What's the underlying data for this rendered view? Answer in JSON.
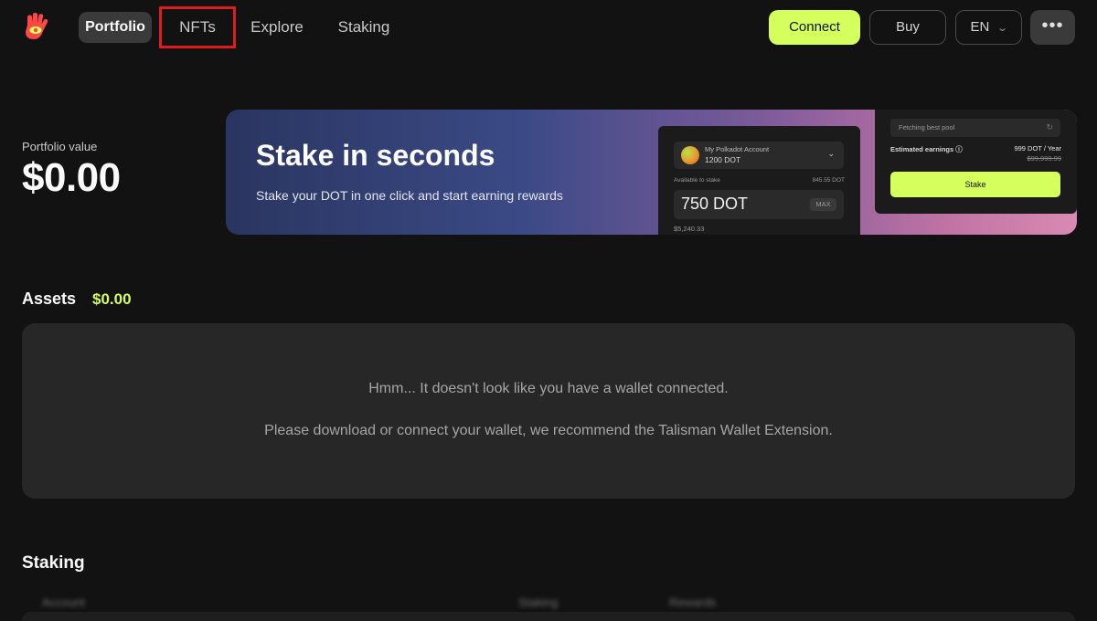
{
  "header": {
    "logo_icon": "talisman-hand-icon",
    "nav": [
      {
        "label": "Portfolio",
        "active": true
      },
      {
        "label": "NFTs",
        "highlighted": true
      },
      {
        "label": "Explore"
      },
      {
        "label": "Staking"
      }
    ],
    "connect_label": "Connect",
    "buy_label": "Buy",
    "language": "EN",
    "more_icon": "ellipsis-icon"
  },
  "portfolio": {
    "label": "Portfolio value",
    "value": "$0.00"
  },
  "banner": {
    "title": "Stake in seconds",
    "subtitle": "Stake your DOT in one click and start earning rewards",
    "account_name": "My Polkadot Account",
    "account_balance": "1200 DOT",
    "available_label": "Available to stake",
    "available_value": "845.55 DOT",
    "amount": "750 DOT",
    "max_label": "MAX",
    "fiat_value": "$5,240.33",
    "pool_placeholder": "Fetching best pool",
    "earnings_label": "Estimated earnings",
    "earnings_value": "999 DOT / Year",
    "earnings_old": "$99,999.99",
    "stake_label": "Stake"
  },
  "assets": {
    "title": "Assets",
    "total": "$0.00",
    "empty_message_1": "Hmm... It doesn't look like you have a wallet connected.",
    "empty_message_2": "Please download or connect your wallet, we recommend the Talisman Wallet Extension."
  },
  "staking": {
    "title": "Staking",
    "columns": [
      "Account",
      "Staking",
      "Rewards"
    ]
  },
  "colors": {
    "accent": "#d5ff5c",
    "background": "#121212",
    "panel": "#272727",
    "highlight": "#e01b1b"
  }
}
